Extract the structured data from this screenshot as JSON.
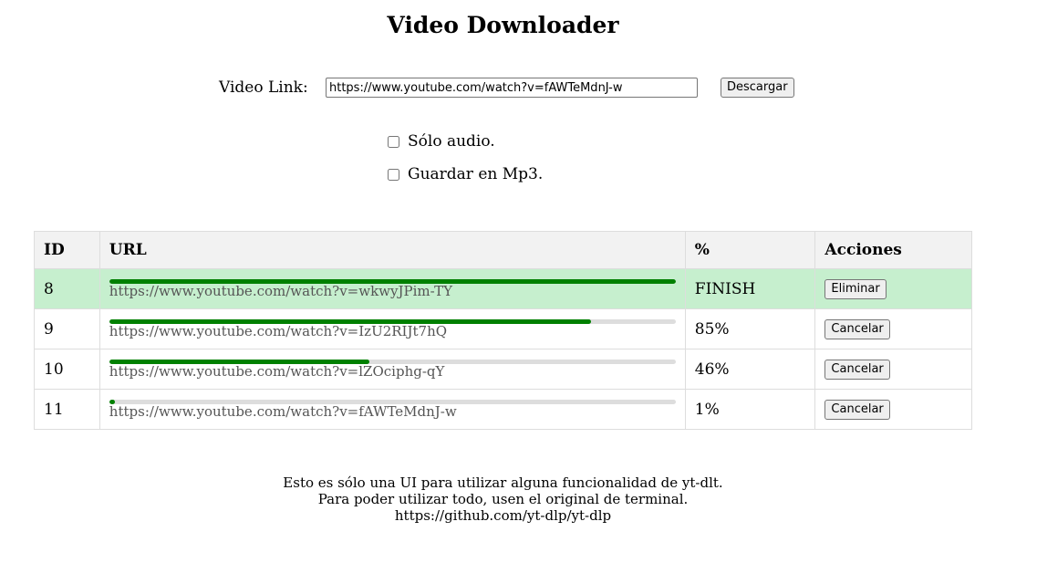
{
  "title": "Video Downloader",
  "form": {
    "link_label": "Video Link:",
    "link_value": "https://www.youtube.com/watch?v=fAWTeMdnJ-w",
    "download_button": "Descargar",
    "audio_only_label": "Sólo audio.",
    "audio_only_checked": false,
    "mp3_label": "Guardar en Mp3.",
    "mp3_checked": false
  },
  "table": {
    "headers": [
      "ID",
      "URL",
      "%",
      "Acciones"
    ],
    "rows": [
      {
        "id": "8",
        "url": "https://www.youtube.com/watch?v=wkwyJPim-TY",
        "progress": 1.0,
        "status": "FINISH",
        "action": "Eliminar",
        "finished": true
      },
      {
        "id": "9",
        "url": "https://www.youtube.com/watch?v=IzU2RIJt7hQ",
        "progress": 0.85,
        "status": "85%",
        "action": "Cancelar",
        "finished": false
      },
      {
        "id": "10",
        "url": "https://www.youtube.com/watch?v=lZOciphg-qY",
        "progress": 0.46,
        "status": "46%",
        "action": "Cancelar",
        "finished": false
      },
      {
        "id": "11",
        "url": "https://www.youtube.com/watch?v=fAWTeMdnJ-w",
        "progress": 0.01,
        "status": "1%",
        "action": "Cancelar",
        "finished": false
      }
    ]
  },
  "footer": {
    "line1": "Esto es sólo una UI para utilizar alguna funcionalidad de yt-dlt.",
    "line2": "Para poder utilizar todo, usen el original de terminal.",
    "line3": "https://github.com/yt-dlp/yt-dlp"
  },
  "colors": {
    "progress_fill": "#008000",
    "progress_track": "#dddddd",
    "finished_row": "#c6efce"
  }
}
